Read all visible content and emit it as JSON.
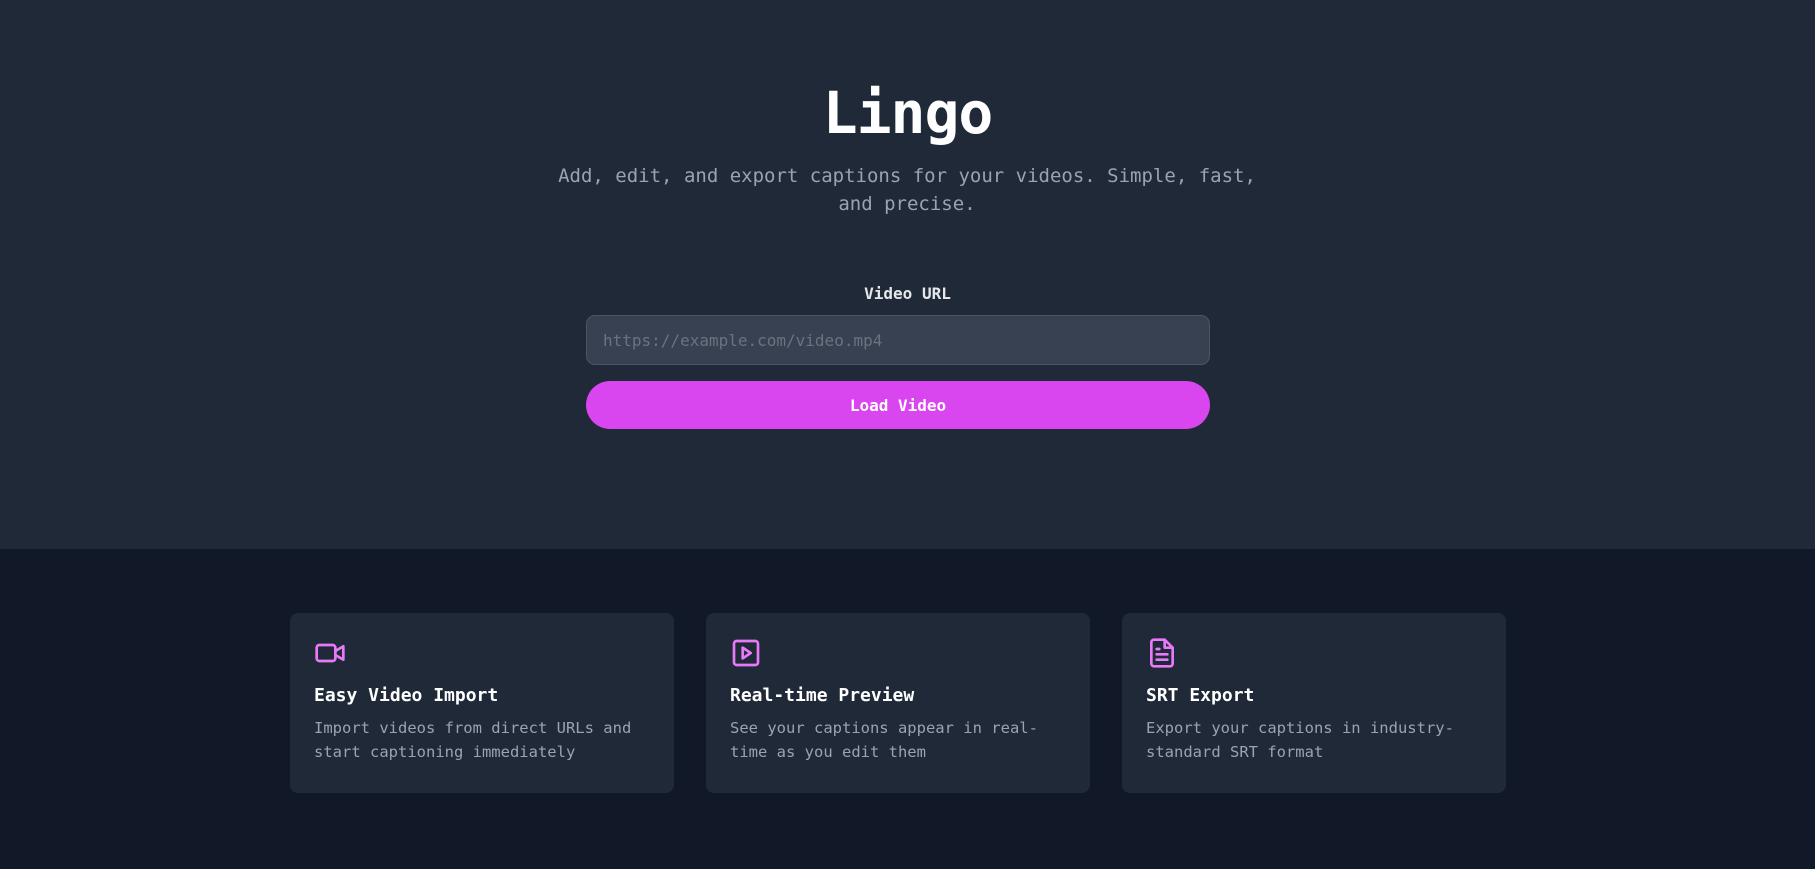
{
  "hero": {
    "title": "Lingo",
    "subtitle": "Add, edit, and export captions for your videos. Simple, fast, and precise."
  },
  "url_form": {
    "label": "Video URL",
    "placeholder": "https://example.com/video.mp4",
    "value": "",
    "button_label": "Load Video"
  },
  "features": [
    {
      "icon": "video-camera-icon",
      "title": "Easy Video Import",
      "description": "Import videos from direct URLs and start captioning immediately"
    },
    {
      "icon": "play-square-icon",
      "title": "Real-time Preview",
      "description": "See your captions appear in real-time as you edit them"
    },
    {
      "icon": "document-icon",
      "title": "SRT Export",
      "description": "Export your captions in industry-standard SRT format"
    }
  ],
  "colors": {
    "accent": "#d946ef",
    "icon": "#e879f9",
    "hero_bg": "#1f2937",
    "page_bg": "#111827",
    "card_bg": "#1f2937",
    "input_bg": "#374151"
  }
}
